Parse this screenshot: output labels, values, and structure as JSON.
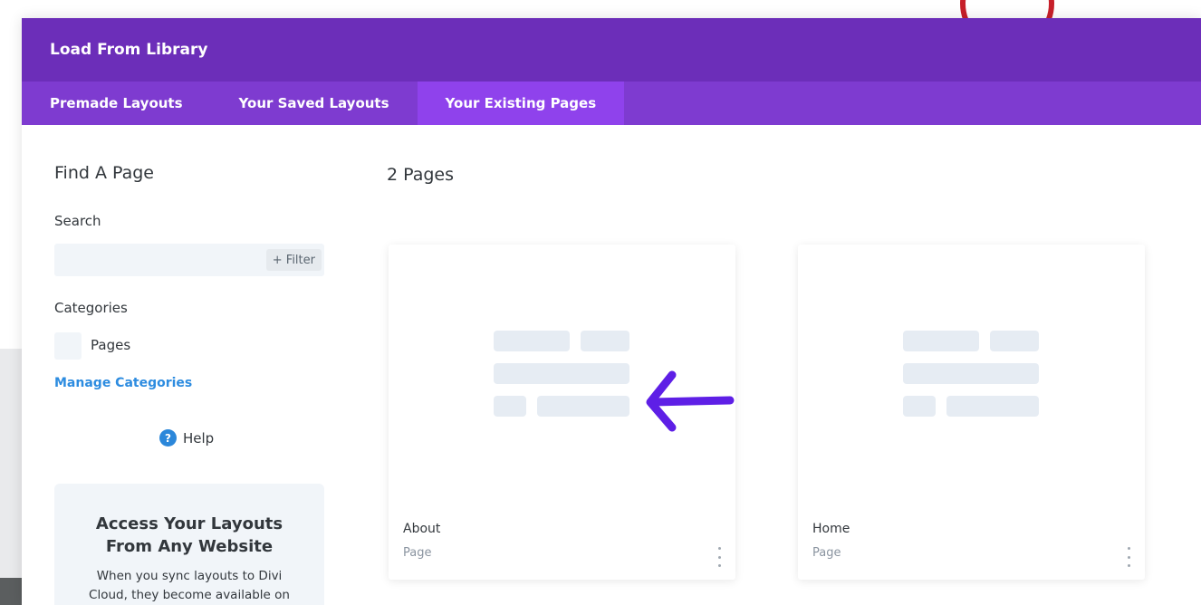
{
  "modal": {
    "title": "Load From Library",
    "tabs": [
      {
        "label": "Premade Layouts",
        "active": false
      },
      {
        "label": "Your Saved Layouts",
        "active": false
      },
      {
        "label": "Your Existing Pages",
        "active": true
      }
    ]
  },
  "sidebar": {
    "title": "Find A Page",
    "search_label": "Search",
    "search_value": "",
    "filter_label": "+ Filter",
    "categories_label": "Categories",
    "categories": [
      {
        "label": "Pages",
        "checked": false
      }
    ],
    "manage_link": "Manage Categories",
    "help_label": "Help",
    "help_icon": "question-circle-icon",
    "promo": {
      "title": "Access Your Layouts From Any Website",
      "text": "When you sync layouts to Divi Cloud, they become available on"
    }
  },
  "main": {
    "count_label": "2 Pages",
    "cards": [
      {
        "name": "About",
        "type": "Page"
      },
      {
        "name": "Home",
        "type": "Page"
      }
    ]
  },
  "colors": {
    "header": "#6c2eb9",
    "tabs_bar": "#7e3bd0",
    "active_tab": "#8f42ec",
    "link": "#2d8ce0",
    "arrow": "#5e1fe6"
  }
}
